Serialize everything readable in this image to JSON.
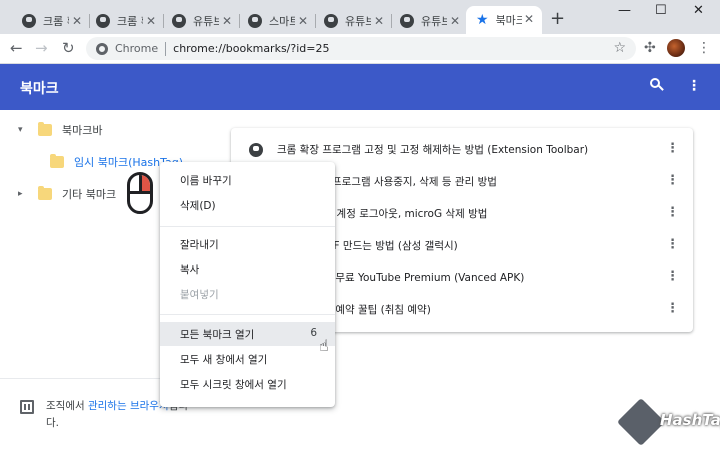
{
  "tabs": [
    {
      "title": "크롬 확",
      "active": false
    },
    {
      "title": "크롬 확",
      "active": false
    },
    {
      "title": "유튜브",
      "active": false
    },
    {
      "title": "스마트",
      "active": false
    },
    {
      "title": "유튜브",
      "active": false
    },
    {
      "title": "유튜브",
      "active": false
    },
    {
      "title": "북마크",
      "active": true
    }
  ],
  "window": {
    "minimize": "—",
    "maximize": "☐",
    "close": "✕",
    "new_tab": "+"
  },
  "toolbar": {
    "back": "←",
    "forward": "→",
    "reload": "↻",
    "origin": "Chrome",
    "url": "chrome://bookmarks/?id=25"
  },
  "header": {
    "title": "북마크"
  },
  "sidebar": {
    "items": [
      {
        "label": "북마크바",
        "arrow": "▾"
      },
      {
        "label": "임시 북마크(HashTag)"
      },
      {
        "label": "기타 북마크",
        "arrow": "▸"
      }
    ],
    "managed": {
      "pre": "조직에서 ",
      "link": "관리하는 브라우저",
      "post": "입니다."
    }
  },
  "bookmarks": [
    {
      "title": "크롬 확장 프로그램 고정 및 고정 해제하는 방법 (Extension Toolbar)"
    },
    {
      "title": "부족시 확장 프로그램 사용중지, 삭제 등 관리 방법"
    },
    {
      "title": "드(Vanced) 계정 로그아웃, microG 삭제 방법"
    },
    {
      "title": "영상 움짤 GIF 만드는 방법 (삼성 갤럭시)"
    },
    {
      "title": "없이 보는법, 무료 YouTube Premium (Vanced APK)"
    },
    {
      "title": "전 시청할 때 예약 꿀팁 (취침 예약)"
    }
  ],
  "context_menu": {
    "rename": "이름 바꾸기",
    "delete": "삭제(D)",
    "cut": "잘라내기",
    "copy": "복사",
    "paste": "붙여넣기",
    "open_all": "모든 북마크 열기",
    "open_all_count": "6",
    "open_all_new_window": "모두 새 창에서 열기",
    "open_all_incognito": "모두 시크릿 창에서 열기"
  },
  "watermark": {
    "text": "HashTag"
  },
  "colors": {
    "header": "#3c59c8",
    "accent": "#1a73e8",
    "folder": "#f7d77b",
    "mouse_button": "#e05546"
  }
}
